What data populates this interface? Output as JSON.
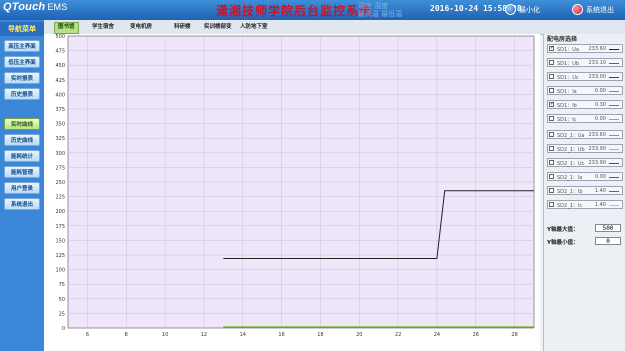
{
  "header": {
    "logo": "QTouch",
    "logo_suffix": "EMS",
    "title": "潇湘技师学院后台监控系统",
    "ghost_line1": "温度 湿度",
    "ghost_line2": "最高温 最低温",
    "datetime": "2016-10-24 15:58:28",
    "minimize_label": "最小化",
    "exit_label": "系统退出"
  },
  "sidebar": {
    "heading": "导航菜单",
    "items": [
      {
        "label": "高压主界面"
      },
      {
        "label": "低压主界面"
      },
      {
        "label": "实时报表"
      },
      {
        "label": "历史报表"
      },
      {
        "label": "实时曲线"
      },
      {
        "label": "历史曲线"
      },
      {
        "label": "能耗统计"
      },
      {
        "label": "能耗管理"
      },
      {
        "label": "用户登录"
      },
      {
        "label": "系统退出"
      }
    ],
    "active_index": 4
  },
  "tabs": [
    {
      "label": "图书馆"
    },
    {
      "label": "学生宿舍"
    },
    {
      "label": "变电机房"
    },
    {
      "label": "科研楼"
    },
    {
      "label": "实训楼部变"
    },
    {
      "label": "人防地下室"
    }
  ],
  "right_panel": {
    "heading": "配电房选择",
    "rows": [
      {
        "label": "SD1：Ua",
        "value": "233.60",
        "checked": true,
        "color": "#222222"
      },
      {
        "label": "SD1：Ub",
        "value": "233.10",
        "checked": false,
        "color": "#d03030"
      },
      {
        "label": "SD1：Uc",
        "value": "233.00",
        "checked": false,
        "color": "#3030c0"
      },
      {
        "label": "SD1：Ia",
        "value": "0.00",
        "checked": false,
        "color": "#888888"
      },
      {
        "label": "SD1：Ib",
        "value": "0.30",
        "checked": true,
        "color": "#c040c0"
      },
      {
        "label": "SD1：Ic",
        "value": "0.00",
        "checked": false,
        "color": "#7cc43c"
      },
      {
        "label": "SD2_1：Ua",
        "value": "233.60",
        "checked": false,
        "color": "#60b060"
      },
      {
        "label": "SD2_1：Ub",
        "value": "233.90",
        "checked": false,
        "color": "#c0c040"
      },
      {
        "label": "SD2_1：Uc",
        "value": "233.90",
        "checked": false,
        "color": "#4040c0"
      },
      {
        "label": "SD2_1：Ia",
        "value": "0.00",
        "checked": false,
        "color": "#c03030"
      },
      {
        "label": "SD2_1：Ib",
        "value": "1.40",
        "checked": false,
        "color": "#4060c0"
      },
      {
        "label": "SD2_1：Ic",
        "value": "1.40",
        "checked": false,
        "color": "#c0c0c0"
      }
    ],
    "y_max_label": "Y轴最大值：",
    "y_max_value": "500",
    "y_min_label": "Y轴最小值：",
    "y_min_value": "0"
  },
  "chart_data": {
    "type": "line",
    "xlim": [
      5,
      29
    ],
    "ylim": [
      0,
      500
    ],
    "x_ticks": [
      6,
      8,
      10,
      12,
      14,
      16,
      18,
      20,
      22,
      24,
      26,
      28
    ],
    "y_ticks": [
      0,
      25,
      50,
      75,
      100,
      125,
      150,
      175,
      200,
      225,
      250,
      275,
      300,
      325,
      350,
      375,
      400,
      425,
      450,
      475,
      500
    ],
    "grid": true,
    "background": "#f0e6fa",
    "series": [
      {
        "color": "#222222",
        "x": [
          13,
          24,
          24.4,
          29
        ],
        "y": [
          119,
          119,
          235,
          235
        ]
      },
      {
        "color": "#c040c0",
        "x": [
          13,
          29
        ],
        "y": [
          1,
          1
        ]
      },
      {
        "color": "#7cc43c",
        "x": [
          13,
          29
        ],
        "y": [
          2,
          2
        ]
      }
    ]
  }
}
